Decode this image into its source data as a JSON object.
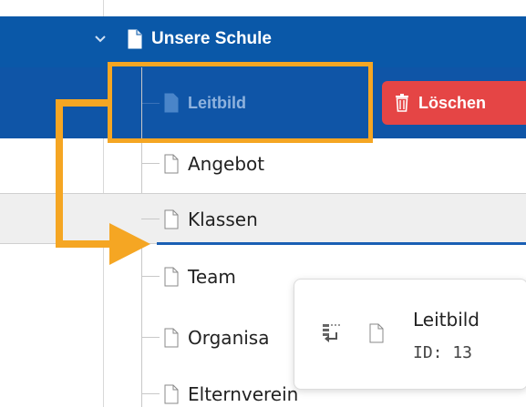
{
  "tree": {
    "parent": {
      "label": "Unsere Schule"
    },
    "dragged": {
      "label": "Leitbild"
    },
    "children": [
      {
        "label": "Angebot"
      },
      {
        "label": "Klassen"
      },
      {
        "label": "Team"
      },
      {
        "label": "Organisa"
      },
      {
        "label": "Elternverein"
      }
    ]
  },
  "actions": {
    "delete_label": "Löschen"
  },
  "drag_tooltip": {
    "title": "Leitbild",
    "id_text": "ID: 13"
  },
  "colors": {
    "selected_row": "#0a58a8",
    "delete": "#e54545",
    "annotation": "#f5a623",
    "drop_indicator": "#1a5fb4"
  },
  "icons": {
    "expand": "chevron-down-icon",
    "page": "page-icon",
    "trash": "trash-icon",
    "move": "move-page-icon"
  }
}
